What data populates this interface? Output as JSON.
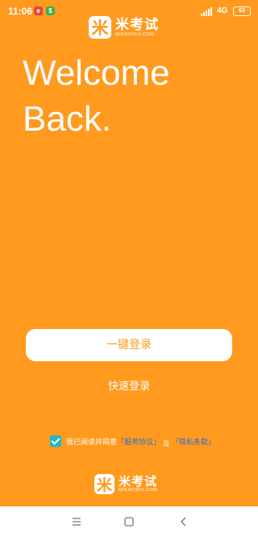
{
  "status_bar": {
    "time": "11:06",
    "notification_icons": [
      "red-app-icon",
      "green-app-icon"
    ],
    "network": "4G",
    "battery": "63"
  },
  "header": {
    "logo_icon": "米",
    "logo_name": "米考试",
    "logo_domain": "MIKAOSHI.COM"
  },
  "welcome": {
    "heading": "Welcome\nBack."
  },
  "actions": {
    "one_click_login": "一键登录",
    "quick_login": "快速登录"
  },
  "agreement": {
    "checked": true,
    "text": "我已阅读并同意",
    "service_link": "「服务协议」",
    "connector": "及",
    "privacy_link": "「隐私条款」"
  },
  "footer": {
    "logo_icon": "米",
    "logo_name": "米考试",
    "logo_domain": "MIKAOSHI.COM"
  },
  "colors": {
    "background": "#FF9A1F",
    "button_text": "#FF9A1F",
    "checkbox": "#1eb8c6",
    "link": "#2d6fd2"
  },
  "nav_bar": {
    "icons": [
      "menu-icon",
      "home-icon",
      "back-icon"
    ]
  }
}
